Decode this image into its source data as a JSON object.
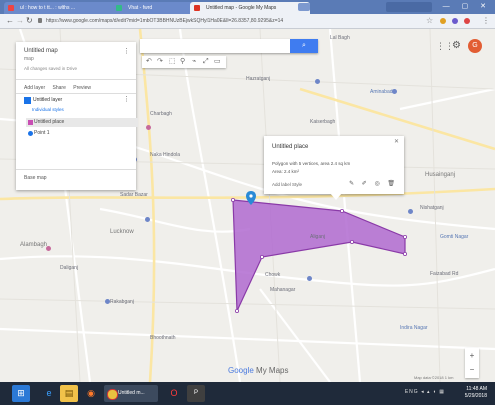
{
  "browser": {
    "tabs": [
      {
        "label": "ul : how to t tt... : wlths   ...",
        "active": false
      },
      {
        "label": "Vhat - fwrd",
        "active": false
      },
      {
        "label": "Untitled map - Google My Maps",
        "active": true
      }
    ],
    "user_chip": "",
    "url": "https://www.google.com/maps/d/edit?mid=1mbOT3BBHNUzBEjwkSQHyl1Ha0E&ll=26.8357,80.9295&z=14",
    "window_controls": "— ▢ ✕"
  },
  "search": {
    "placeholder": "",
    "button_icon": "search-icon"
  },
  "toolbar": {
    "items": [
      "↶",
      "↷",
      "⬚",
      "⚲",
      "⌁",
      "⤢",
      "▭"
    ]
  },
  "account": {
    "avatar_letter": "G"
  },
  "panel": {
    "title": "Untitled map",
    "subtitle": "map",
    "description": "All changes saved in Drive",
    "actions": [
      "Add layer",
      "Share",
      "Preview"
    ],
    "layer_name": "Untitled layer",
    "style_label": "Individual styles",
    "features": [
      {
        "name": "Untitled place",
        "color": "#c84eb3",
        "selected": true
      },
      {
        "name": "Point 1",
        "color": "#1a73e8",
        "selected": false
      }
    ],
    "basemap_label": "Base map"
  },
  "popup": {
    "title": "Untitled place",
    "description": "Polygon with 5 vertices, area 2.4 sq km",
    "meta": "Area: 2.4 km²",
    "footer": "Add label   Style",
    "tools": "✎ ✐ ◎ 🗑"
  },
  "map_labels": [
    {
      "text": "Lal Bagh",
      "cls": ""
    },
    {
      "text": "Hazratganj",
      "cls": ""
    },
    {
      "text": "Charbagh",
      "cls": ""
    },
    {
      "text": "Aminabad",
      "cls": "blue"
    },
    {
      "text": "Kaiserbagh",
      "cls": ""
    },
    {
      "text": "Naka Hindola",
      "cls": ""
    },
    {
      "text": "Husainganj",
      "cls": "big"
    },
    {
      "text": "Sadar Bazar",
      "cls": ""
    },
    {
      "text": "Alambagh",
      "cls": "big"
    },
    {
      "text": "Nishatganj",
      "cls": ""
    },
    {
      "text": "Gomti Nagar",
      "cls": "blue"
    },
    {
      "text": "Daliganj",
      "cls": ""
    },
    {
      "text": "Rakabganj",
      "cls": ""
    },
    {
      "text": "Chowk",
      "cls": ""
    },
    {
      "text": "Mahanagar",
      "cls": ""
    },
    {
      "text": "Aliganj",
      "cls": ""
    },
    {
      "text": "Indira Nagar",
      "cls": "blue"
    },
    {
      "text": "Bhoothnath",
      "cls": ""
    },
    {
      "text": "Faizabad Rd",
      "cls": ""
    },
    {
      "text": "Lucknow",
      "cls": "big"
    }
  ],
  "zoom": {
    "plus": "+",
    "minus": "−"
  },
  "branding": {
    "logo_word": "Google",
    "product": "My Maps",
    "attribution": "Map data ©2018  1 km"
  },
  "taskbar": {
    "chrome_label": "Untitled m...",
    "app_label": "P",
    "tray": "ENG ◂ ▴ ◖ ▦",
    "time": "11:48 AM",
    "date": "5/29/2018"
  },
  "colors": {
    "polygon_fill": "#b06ad0",
    "polygon_stroke": "#8a3aa8",
    "accent": "#3f7cf0"
  }
}
